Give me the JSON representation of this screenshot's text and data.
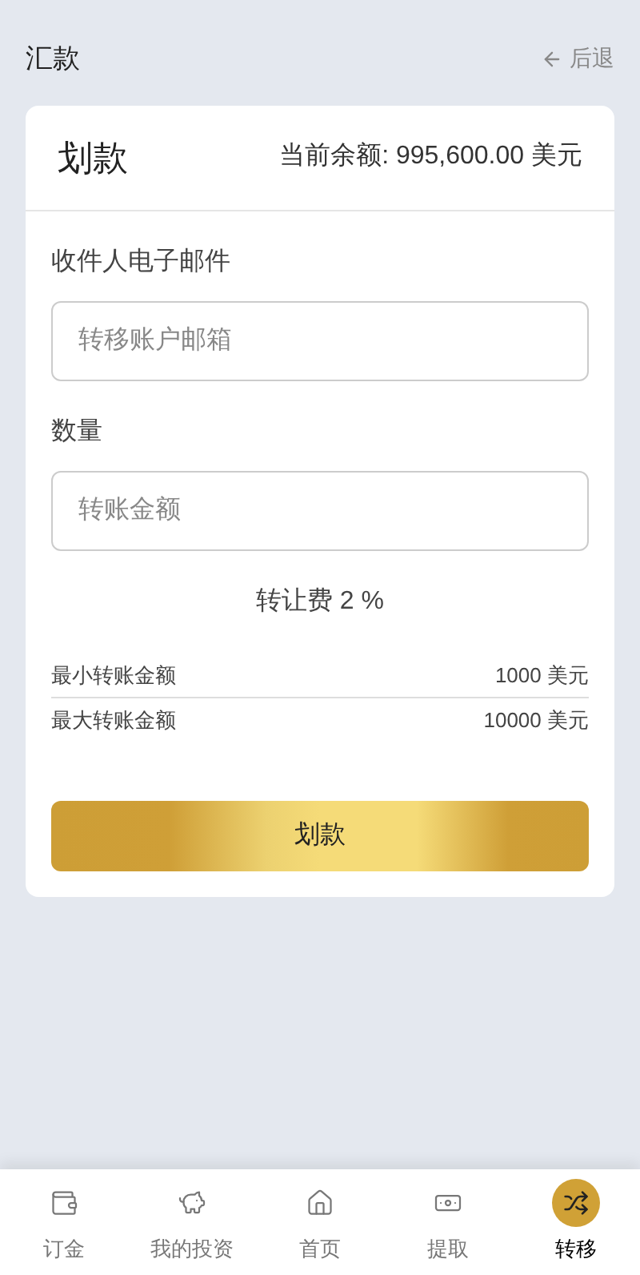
{
  "header": {
    "title": "汇款",
    "back": "后退"
  },
  "card": {
    "title": "划款",
    "balance_label": "当前余额:",
    "balance": "995,600.00 美元"
  },
  "fields": [
    {
      "label": "收件人电子邮件",
      "placeholder": "转移账户邮箱"
    },
    {
      "label": "数量",
      "placeholder": "转账金额"
    }
  ],
  "fee": "转让费 2 %",
  "limits": [
    {
      "label": "最小转账金额",
      "value": "1000 美元"
    },
    {
      "label": "最大转账金额",
      "value": "10000 美元"
    }
  ],
  "submit": "划款",
  "nav": [
    {
      "kind": "wallet",
      "label": "订金",
      "selected": false
    },
    {
      "kind": "piggy",
      "label": "我的投资",
      "selected": false
    },
    {
      "kind": "home",
      "label": "首页",
      "selected": false
    },
    {
      "kind": "cash",
      "label": "提取",
      "selected": false
    },
    {
      "kind": "shuffle",
      "label": "转移",
      "selected": true
    }
  ]
}
